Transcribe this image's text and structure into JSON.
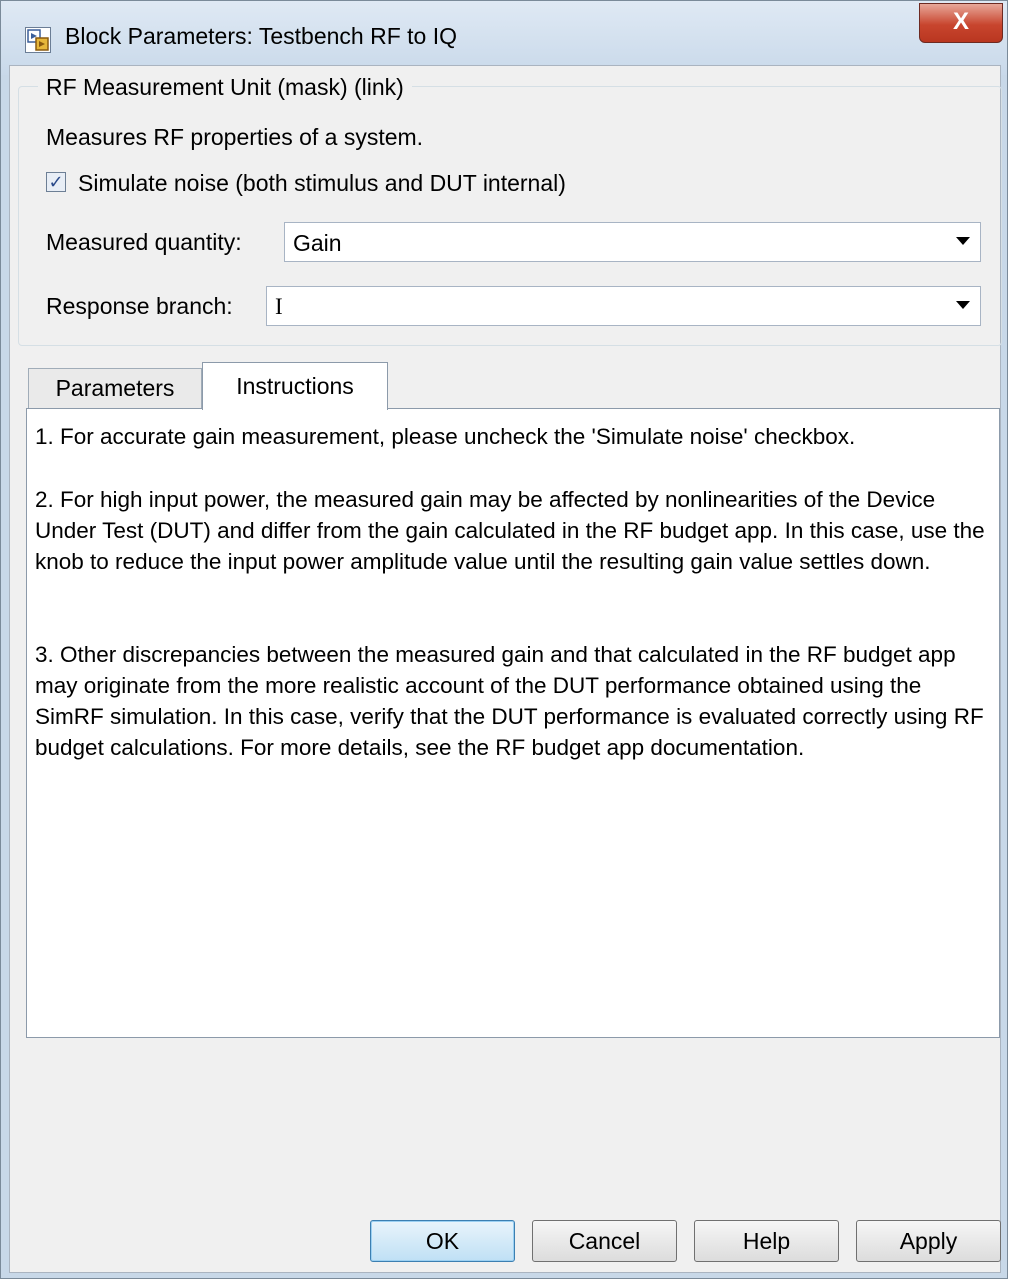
{
  "window": {
    "title": "Block Parameters: Testbench RF to IQ",
    "close_symbol": "X"
  },
  "mask": {
    "group_title": "RF Measurement Unit (mask) (link)",
    "description": "Measures RF properties of a system.",
    "simulate_noise": {
      "label": "Simulate noise (both stimulus and DUT internal)",
      "checked": true,
      "check_mark": "✓"
    },
    "measured_quantity": {
      "label": "Measured quantity:",
      "value": "Gain"
    },
    "response_branch": {
      "label": "Response branch:",
      "value": "I"
    }
  },
  "tabs": [
    {
      "label": "Parameters",
      "active": false
    },
    {
      "label": "Instructions",
      "active": true
    }
  ],
  "instructions": [
    "1. For accurate gain measurement, please uncheck the 'Simulate noise' checkbox.",
    "2. For high input power, the measured gain may be affected by nonlinearities of the Device Under Test (DUT) and differ from the gain calculated in the RF budget app. In this case, use the knob to reduce the input power amplitude value until the resulting gain value settles down.",
    "3. Other discrepancies between the measured gain and that calculated in the RF budget app may originate from the more realistic account of the DUT performance obtained using the SimRF simulation. In this case, verify that the DUT performance is evaluated correctly using RF budget calculations. For more details, see the RF budget app documentation."
  ],
  "buttons": {
    "ok": "OK",
    "cancel": "Cancel",
    "help": "Help",
    "apply": "Apply"
  },
  "icons": {
    "app": "simulink-block-icon",
    "close": "close-icon",
    "dropdown": "chevron-down-icon"
  },
  "colors": {
    "titlebar": "#c9d9ea",
    "close_button": "#c8452e",
    "dialog_bg": "#f0f0f0",
    "default_button": "#bfe0f5"
  }
}
